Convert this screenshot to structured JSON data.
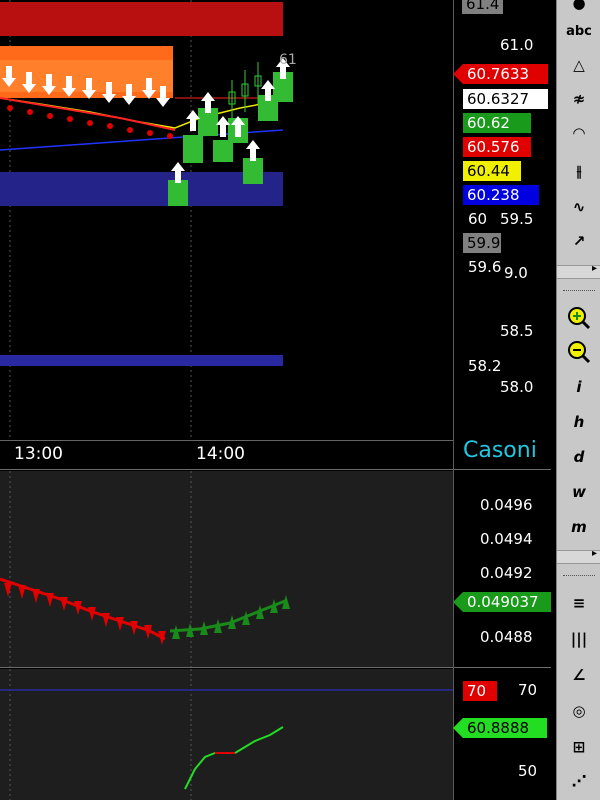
{
  "price_pane": {
    "axis_labels": [
      "61.0",
      "60",
      "59.5",
      "59.6",
      "9.0",
      "58.5",
      "58.2",
      "58.0"
    ],
    "top_label": "61.4",
    "tags": [
      {
        "text": "60.7633",
        "bg": "#e00000",
        "fg": "#ffffff"
      },
      {
        "text": "60.6327",
        "bg": "#ffffff",
        "fg": "#000000"
      },
      {
        "text": "60.62",
        "bg": "#1a9a1a",
        "fg": "#ffffff"
      },
      {
        "text": "60.576",
        "bg": "#e00000",
        "fg": "#ffffff"
      },
      {
        "text": "60.44",
        "bg": "#f0f000",
        "fg": "#000000"
      },
      {
        "text": "60.238",
        "bg": "#0000e0",
        "fg": "#ffffff"
      },
      {
        "text": "59.9",
        "bg": "#808080",
        "fg": "#000000"
      }
    ],
    "time_labels": [
      "13:00",
      "14:00"
    ],
    "watermark": "Casoni",
    "corner_marker": "61"
  },
  "indicator1": {
    "axis_labels": [
      "0.0496",
      "0.0494",
      "0.0492",
      "0.0488"
    ],
    "tag": {
      "text": "0.049037",
      "bg": "#1a9a1a",
      "fg": "#ffffff"
    }
  },
  "indicator2": {
    "axis_labels": [
      "70",
      "50"
    ],
    "tag_red": {
      "text": "70",
      "bg": "#e00000",
      "fg": "#ffffff"
    },
    "tag_green": {
      "text": "60.8888",
      "bg": "#22dd22",
      "fg": "#000000"
    }
  },
  "toolbar": {
    "top_group": [
      "abc",
      "△",
      "≉",
      "◠",
      "⫲",
      "∿",
      "↗"
    ],
    "zoom_group": [
      "zoom-in",
      "zoom-out"
    ],
    "period_group": [
      "i",
      "h",
      "d",
      "w",
      "m"
    ],
    "bottom_group": [
      "≡",
      "|||",
      "∠",
      "◎",
      "⊞",
      "⋰"
    ]
  },
  "colors": {
    "bull": "#33cc33",
    "bear": "#e00000",
    "band_orange": "#ff6a1a",
    "band_navy": "#23238a",
    "band_red": "#b81010",
    "axis_text": "#ffffff",
    "background": "#000000",
    "indicator_bg": "#1e1e1e"
  }
}
